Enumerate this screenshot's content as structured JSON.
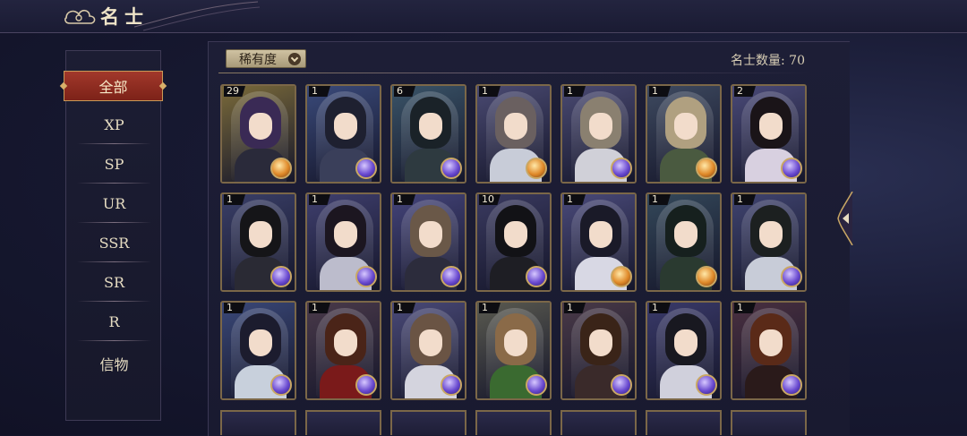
{
  "header": {
    "title": "名士"
  },
  "sidebar": {
    "items": [
      {
        "label": "全部",
        "active": true
      },
      {
        "label": "XP"
      },
      {
        "label": "SP"
      },
      {
        "label": "UR"
      },
      {
        "label": "SSR"
      },
      {
        "label": "SR"
      },
      {
        "label": "R"
      },
      {
        "label": "信物"
      }
    ]
  },
  "filter": {
    "label": "稀有度"
  },
  "count_text": "名士数量: 70",
  "cards": [
    {
      "count": "29",
      "bg": "#7a6a3a",
      "hair": "#3a2a55",
      "body": "#2a2a3a",
      "orb": "gold"
    },
    {
      "count": "1",
      "bg": "#3a4a7a",
      "hair": "#1e2030",
      "body": "#3a3f5a",
      "orb": "blue"
    },
    {
      "count": "6",
      "bg": "#3a5468",
      "hair": "#1a2228",
      "body": "#2e3a40",
      "orb": "blue"
    },
    {
      "count": "1",
      "bg": "#4a4a72",
      "hair": "#6a6060",
      "body": "#c8ccd8",
      "orb": "gold"
    },
    {
      "count": "1",
      "bg": "#4a4a72",
      "hair": "#8a8070",
      "body": "#d0d0d8",
      "orb": "blue"
    },
    {
      "count": "1",
      "bg": "#3e4a60",
      "hair": "#b0a080",
      "body": "#4a5a40",
      "orb": "gold"
    },
    {
      "count": "2",
      "bg": "#4a4a78",
      "hair": "#1a1418",
      "body": "#d8d0e0",
      "orb": "blue"
    },
    {
      "count": "1",
      "bg": "#3a3f68",
      "hair": "#151518",
      "body": "#2a2a34",
      "orb": "blue"
    },
    {
      "count": "1",
      "bg": "#3f3f6e",
      "hair": "#1c1620",
      "body": "#bcbccc",
      "orb": "blue"
    },
    {
      "count": "1",
      "bg": "#44447a",
      "hair": "#6a5848",
      "body": "#2c2c3c",
      "orb": "blue"
    },
    {
      "count": "10",
      "bg": "#3a3a60",
      "hair": "#121216",
      "body": "#1e1e24",
      "orb": "blue"
    },
    {
      "count": "1",
      "bg": "#4a4a7a",
      "hair": "#1a1a28",
      "body": "#d8d8e4",
      "orb": "gold"
    },
    {
      "count": "1",
      "bg": "#34485a",
      "hair": "#16201e",
      "body": "#2a3a30",
      "orb": "gold"
    },
    {
      "count": "1",
      "bg": "#404470",
      "hair": "#1c2020",
      "body": "#c8ccd8",
      "orb": "blue"
    },
    {
      "count": "1",
      "bg": "#3a4878",
      "hair": "#1c1c2e",
      "body": "#c8d0dc",
      "orb": "blue"
    },
    {
      "count": "1",
      "bg": "#4a3a4a",
      "hair": "#4a2418",
      "body": "#7a1a1a",
      "orb": "blue"
    },
    {
      "count": "1",
      "bg": "#4a4a78",
      "hair": "#6a5444",
      "body": "#d4d4de",
      "orb": "blue"
    },
    {
      "count": "1",
      "bg": "#5a5a50",
      "hair": "#8a6a48",
      "body": "#3a6a30",
      "orb": "blue"
    },
    {
      "count": "1",
      "bg": "#4a3a48",
      "hair": "#3a2418",
      "body": "#3a2a2a",
      "orb": "blue"
    },
    {
      "count": "1",
      "bg": "#3a3a6a",
      "hair": "#181820",
      "body": "#d0d0dc",
      "orb": "blue"
    },
    {
      "count": "1",
      "bg": "#4a3040",
      "hair": "#5a2a18",
      "body": "#2a1a1a",
      "orb": "blue"
    }
  ],
  "colors": {
    "accent": "#a2382b",
    "frame": "#7b6748"
  }
}
